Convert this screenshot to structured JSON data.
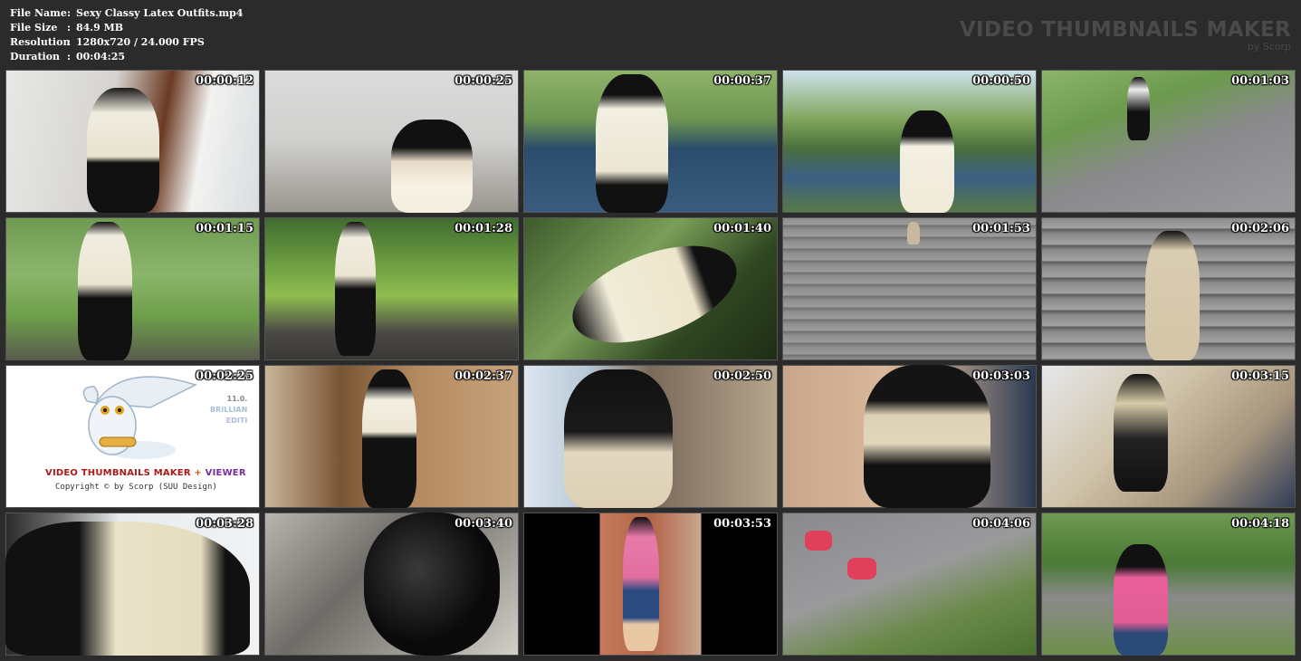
{
  "info": {
    "rows": [
      {
        "label": "File Name",
        "sep": ":",
        "value": "Sexy Classy Latex Outfits.mp4"
      },
      {
        "label": "File Size",
        "sep": ":",
        "value": "84.9 MB"
      },
      {
        "label": "Resolution",
        "sep": ":",
        "value": "1280x720 / 24.000 FPS"
      },
      {
        "label": "Duration",
        "sep": ":",
        "value": "00:04:25"
      }
    ]
  },
  "brand": {
    "title": "VIDEO THUMBNAILS MAKER",
    "subtitle": "by Scorp"
  },
  "logo": {
    "title_part1": "VIDEO THUMBNAILS MAKER",
    "title_plus": " + ",
    "title_part2": "VIEWER",
    "copyright": "Copyright © by Scorp (SUU Design)",
    "version": "11.0.",
    "edition_line1": "BRILLIAN",
    "edition_line2": "EDITI"
  },
  "thumbnails": [
    {
      "time": "00:00:12"
    },
    {
      "time": "00:00:25"
    },
    {
      "time": "00:00:37"
    },
    {
      "time": "00:00:50"
    },
    {
      "time": "00:01:03"
    },
    {
      "time": "00:01:15"
    },
    {
      "time": "00:01:28"
    },
    {
      "time": "00:01:40"
    },
    {
      "time": "00:01:53"
    },
    {
      "time": "00:02:06"
    },
    {
      "time": "00:02:25"
    },
    {
      "time": "00:02:37"
    },
    {
      "time": "00:02:50"
    },
    {
      "time": "00:03:03"
    },
    {
      "time": "00:03:15"
    },
    {
      "time": "00:03:28"
    },
    {
      "time": "00:03:40"
    },
    {
      "time": "00:03:53"
    },
    {
      "time": "00:04:06"
    },
    {
      "time": "00:04:18"
    }
  ]
}
